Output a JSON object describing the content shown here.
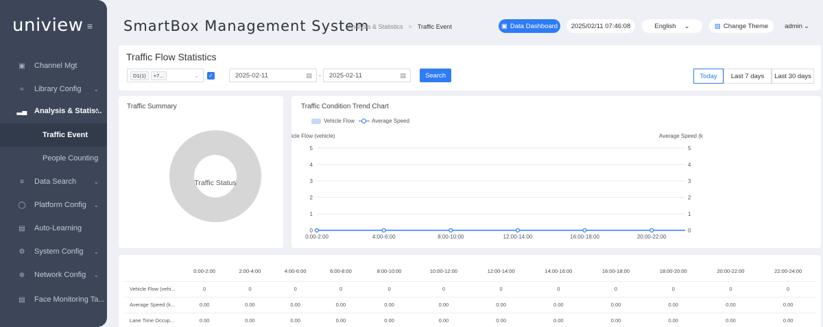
{
  "brand": {
    "logo": "uniview"
  },
  "sidebar": {
    "items": [
      {
        "label": "Channel Mgt",
        "icon": "channel-icon",
        "chevron": ""
      },
      {
        "label": "Library Config",
        "icon": "library-icon",
        "chevron": "⌄"
      },
      {
        "label": "Analysis & Statis...",
        "icon": "chart-icon",
        "chevron": "^"
      },
      {
        "label": "Traffic Event"
      },
      {
        "label": "People Counting"
      },
      {
        "label": "Data Search",
        "icon": "search-icon",
        "chevron": "⌄"
      },
      {
        "label": "Platform Config",
        "icon": "platform-icon",
        "chevron": "⌄"
      },
      {
        "label": "Auto-Learning",
        "icon": "book-icon",
        "chevron": ""
      },
      {
        "label": "System Config",
        "icon": "settings-icon",
        "chevron": "⌄"
      },
      {
        "label": "Network Config",
        "icon": "globe-icon",
        "chevron": "⌄"
      },
      {
        "label": "Face Monitoring Ta...",
        "icon": "monitor-icon",
        "chevron": ""
      }
    ]
  },
  "header": {
    "title": "SmartBox Management System",
    "breadcrumb": {
      "parent": "Analysis & Statistics",
      "separator": ">",
      "current": "Traffic Event"
    },
    "dashboard_label": "Data Dashboard",
    "datetime": "2025/02/11 07:46:08",
    "language": "English",
    "theme_label": "Change Theme",
    "user": "admin"
  },
  "filter": {
    "title": "Traffic Flow Statistics",
    "channel_tags": [
      "D1(1)",
      "+7..."
    ],
    "start_date": "2025-02-11",
    "end_date": "2025-02-11",
    "date_separator": "-",
    "search_label": "Search",
    "ranges": [
      "Today",
      "Last 7 days",
      "Last 30 days"
    ]
  },
  "summary": {
    "title": "Traffic Summary",
    "center_label": "Traffic Status"
  },
  "chart": {
    "title": "Traffic Condition Trend Chart",
    "legend_vehicle": "Vehicle Flow",
    "legend_speed": "Average Speed",
    "left_axis_label": "icle Flow (vehicle)",
    "right_axis_label": "Average Speed (k",
    "y_ticks": [
      "5",
      "4",
      "3",
      "2",
      "1",
      "0"
    ],
    "x_ticks": [
      "0:00-2:00",
      "4:00-6:00",
      "8:00-10:00",
      "12:00-14:00",
      "16:00-18:00",
      "20:00-22:00"
    ]
  },
  "chart_data": {
    "type": "line",
    "title": "Traffic Condition Trend Chart",
    "x": [
      "0:00-2:00",
      "2:00-4:00",
      "4:00-6:00",
      "6:00-8:00",
      "8:00-10:00",
      "10:00-12:00",
      "12:00-14:00",
      "14:00-16:00",
      "16:00-18:00",
      "18:00-20:00",
      "20:00-22:00",
      "22:00-24:00"
    ],
    "series": [
      {
        "name": "Vehicle Flow",
        "type": "area",
        "values": [
          0,
          0,
          0,
          0,
          0,
          0,
          0,
          0,
          0,
          0,
          0,
          0
        ]
      },
      {
        "name": "Average Speed",
        "type": "line",
        "values": [
          0,
          0,
          0,
          0,
          0,
          0,
          0,
          0,
          0,
          0,
          0,
          0
        ]
      }
    ],
    "ylim": [
      0,
      5
    ],
    "ylabel": "icle Flow (vehicle)",
    "y2label": "Average Speed (k",
    "grid": true,
    "legend": "top-left"
  },
  "table": {
    "columns": [
      "0:00-2:00",
      "2:00-4:00",
      "4:00-6:00",
      "6:00-8:00",
      "8:00-10:00",
      "10:00-12:00",
      "12:00-14:00",
      "14:00-16:00",
      "16:00-18:00",
      "18:00-20:00",
      "20:00-22:00",
      "22:00-24:00"
    ],
    "rows": [
      {
        "label": "Vehicle Flow (vehi...",
        "values": [
          "0",
          "0",
          "0",
          "0",
          "0",
          "0",
          "0",
          "0",
          "0",
          "0",
          "0",
          "0"
        ]
      },
      {
        "label": "Average Speed (k...",
        "values": [
          "0.00",
          "0.00",
          "0.00",
          "0.00",
          "0.00",
          "0.00",
          "0.00",
          "0.00",
          "0.00",
          "0.00",
          "0.00",
          "0.00"
        ]
      },
      {
        "label": "Lane Time Occup...",
        "values": [
          "0.00",
          "0.00",
          "0.00",
          "0.00",
          "0.00",
          "0.00",
          "0.00",
          "0.00",
          "0.00",
          "0.00",
          "0.00",
          "0.00"
        ]
      }
    ]
  },
  "colors": {
    "accent": "#2e7cf6",
    "sidebar": "#3c4658",
    "donut": "#d6d6d6"
  }
}
